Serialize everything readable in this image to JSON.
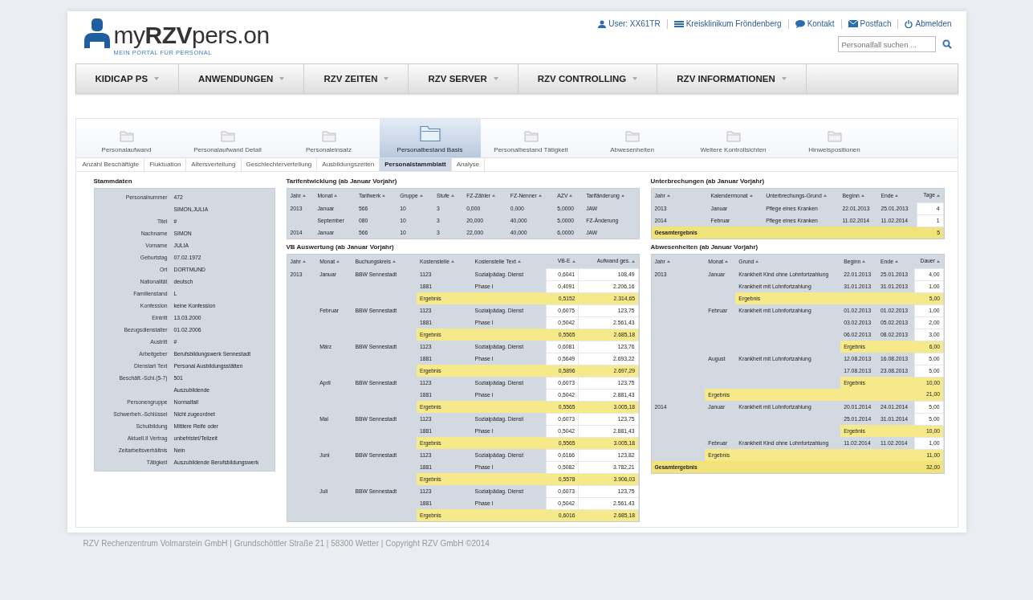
{
  "logo": {
    "name": "my**RZV**pers.on",
    "tagline": "MEIN PORTAL FÜR PERSONAL"
  },
  "top_links": [
    {
      "kind": "user",
      "label": "User: XX61TR"
    },
    {
      "kind": "org",
      "label": "Kreisklinikum Fröndenberg"
    },
    {
      "kind": "contact",
      "label": "Kontakt"
    },
    {
      "kind": "mail",
      "label": "Postfach"
    },
    {
      "kind": "logout",
      "label": "Abmelden"
    }
  ],
  "search": {
    "placeholder": "Personalfall suchen ..."
  },
  "menu": [
    "KIDICAP PS",
    "ANWENDUNGEN",
    "RZV ZEITEN",
    "RZV SERVER",
    "RZV CONTROLLING",
    "RZV INFORMATIONEN"
  ],
  "tabs": [
    {
      "label": "Personalaufwand",
      "selected": false
    },
    {
      "label": "Personalaufwand Detail",
      "selected": false
    },
    {
      "label": "Personaleinsatz",
      "selected": false
    },
    {
      "label": "Personalbestand Basis",
      "selected": true
    },
    {
      "label": "Personalbestand Tätigkeit",
      "selected": false
    },
    {
      "label": "Abwesenheiten",
      "selected": false
    },
    {
      "label": "Weitere Kontrollsichten",
      "selected": false
    },
    {
      "label": "Hinweispositionen",
      "selected": false
    }
  ],
  "subtabs": [
    {
      "label": "Anzahl Beschäftigte",
      "selected": false
    },
    {
      "label": "Fluktuation",
      "selected": false
    },
    {
      "label": "Altersverteilung",
      "selected": false
    },
    {
      "label": "Geschlechterverteilung",
      "selected": false
    },
    {
      "label": "Ausbildungszeiten",
      "selected": false
    },
    {
      "label": "Personalstammblatt",
      "selected": true
    },
    {
      "label": "Analyse",
      "selected": false
    }
  ],
  "stammdaten": {
    "title": "Stammdaten",
    "fields": [
      {
        "label": "Personalnummer",
        "value": "472"
      },
      {
        "value": "SIMON,JULIA"
      },
      {
        "label": "Titel",
        "value": "#"
      },
      {
        "label": "Nachname",
        "value": "SIMON"
      },
      {
        "label": "Vorname",
        "value": "JULIA"
      },
      {
        "label": "Geburtstag",
        "value": "07.02.1972"
      },
      {
        "label": "Ort",
        "value": "DORTMUND"
      },
      {
        "label": "Nationalität",
        "value": "deutsch"
      },
      {
        "label": "Familienstand",
        "value": "L"
      },
      {
        "label": "Konfession",
        "value": "keine Konfession"
      },
      {
        "label": "Eintritt",
        "value": "13.03.2000"
      },
      {
        "label": "Bezugsdienstalter",
        "value": "01.02.2006"
      },
      {
        "label": "Austritt",
        "value": "#"
      },
      {
        "label": "Arbeitgeber",
        "value": "Berufsbildungswerk Sennestadt"
      },
      {
        "label": "Dienstart Text",
        "value": "Personal Ausbildungsstätten"
      },
      {
        "label": "Beschäft.-Schl.(5-7)",
        "value": "501"
      },
      {
        "value": "Auszubildende"
      },
      {
        "label": "Personengruppe",
        "value": "Normalfall"
      },
      {
        "label": "Schwerbeh.-Schlüssel",
        "value": "Nicht zugeordnet"
      },
      {
        "label": "Schulbildung",
        "value": "Mittlere Reife oder"
      },
      {
        "label": "Aktuell.II Vertrag",
        "value": "unbefristet/Teilzeit"
      },
      {
        "label": "Zeitarbeitsverhältnis",
        "value": "Nein"
      },
      {
        "label": "Tätigkeit",
        "value": "Auszubildende Berufsbildungswerk"
      }
    ]
  },
  "tarifentwicklung": {
    "title": "Tarifentwicklung (ab Januar Vorjahr)",
    "columns": [
      {
        "label": "Jahr"
      },
      {
        "label": "Monat"
      },
      {
        "label": "Tarifwerk"
      },
      {
        "label": "Gruppe"
      },
      {
        "label": "Stufe"
      },
      {
        "label": "FZ-Zähler"
      },
      {
        "label": "FZ-Nenner"
      },
      {
        "label": "AZV"
      },
      {
        "label": "Tarifänderung"
      }
    ],
    "rows": [
      {
        "kind": "data",
        "cells": [
          "2013",
          "Januar",
          "566",
          "10",
          "3",
          "0,000",
          "0,000",
          "5,0000",
          "JAW"
        ]
      },
      {
        "kind": "data",
        "cells": [
          null,
          "September",
          "080",
          "10",
          "3",
          "20,000",
          "40,000",
          "5,0000",
          "FZ-Änderung"
        ]
      },
      {
        "kind": "data",
        "cells": [
          "2014",
          "Januar",
          "566",
          "10",
          "3",
          "22,000",
          "40,000",
          "6,0000",
          "JAW"
        ]
      }
    ]
  },
  "vb_auswertung": {
    "title": "VB Auswertung (ab Januar Vorjahr)",
    "columns": [
      {
        "label": "Jahr",
        "kind": "text"
      },
      {
        "label": "Monat",
        "kind": "text"
      },
      {
        "label": "Buchungskreis",
        "kind": "text"
      },
      {
        "label": "Kostenstelle",
        "kind": "text"
      },
      {
        "label": "Kostenstelle Text",
        "kind": "text"
      },
      {
        "label": "VB-E",
        "kind": "number"
      },
      {
        "label": "Aufwand ges.",
        "kind": "number"
      }
    ],
    "rows": [
      {
        "kind": "data",
        "cells": [
          "2013",
          "Januar",
          "BBW Sennestadt",
          "1123",
          "Sozialpädag. Dienst",
          "0,6041",
          "108,49"
        ]
      },
      {
        "kind": "data",
        "cells": [
          null,
          null,
          null,
          "1881",
          "Phase I",
          "0,4091",
          "2.206,16"
        ]
      },
      {
        "kind": "sum",
        "cells": [
          null,
          null,
          null,
          "Ergebnis",
          null,
          "0,5152",
          "2.314,65"
        ]
      },
      {
        "kind": "data",
        "cells": [
          null,
          "Februar",
          "BBW Sennestadt",
          "1123",
          "Sozialpädag. Dienst",
          "0,6075",
          "123,75"
        ]
      },
      {
        "kind": "data",
        "cells": [
          null,
          null,
          null,
          "1881",
          "Phase I",
          "0,5042",
          "2.561,43"
        ]
      },
      {
        "kind": "sum",
        "cells": [
          null,
          null,
          null,
          "Ergebnis",
          null,
          "0,5565",
          "2.685,18"
        ]
      },
      {
        "kind": "data",
        "cells": [
          null,
          "März",
          "BBW Sennestadt",
          "1123",
          "Sozialpädag. Dienst",
          "0,6081",
          "123,76"
        ]
      },
      {
        "kind": "data",
        "cells": [
          null,
          null,
          null,
          "1881",
          "Phase I",
          "0,5649",
          "2.693,22"
        ]
      },
      {
        "kind": "sum",
        "cells": [
          null,
          null,
          null,
          "Ergebnis",
          null,
          "0,5896",
          "2.697,29"
        ]
      },
      {
        "kind": "data",
        "cells": [
          null,
          "April",
          "BBW Sennestadt",
          "1123",
          "Sozialpädag. Dienst",
          "0,6073",
          "123,75"
        ]
      },
      {
        "kind": "data",
        "cells": [
          null,
          null,
          null,
          "1881",
          "Phase I",
          "0,5042",
          "2.881,43"
        ]
      },
      {
        "kind": "sum",
        "cells": [
          null,
          null,
          null,
          "Ergebnis",
          null,
          "0,5565",
          "3.005,18"
        ]
      },
      {
        "kind": "data",
        "cells": [
          null,
          "Mai",
          "BBW Sennestadt",
          "1123",
          "Sozialpädag. Dienst",
          "0,6073",
          "123,75"
        ]
      },
      {
        "kind": "data",
        "cells": [
          null,
          null,
          null,
          "1881",
          "Phase I",
          "0,5042",
          "2.881,43"
        ]
      },
      {
        "kind": "sum",
        "cells": [
          null,
          null,
          null,
          "Ergebnis",
          null,
          "0,5565",
          "3.005,18"
        ]
      },
      {
        "kind": "data",
        "cells": [
          null,
          "Juni",
          "BBW Sennestadt",
          "1123",
          "Sozialpädag. Dienst",
          "0,6166",
          "123,82"
        ]
      },
      {
        "kind": "data",
        "cells": [
          null,
          null,
          null,
          "1881",
          "Phase I",
          "0,5082",
          "3.782,21"
        ]
      },
      {
        "kind": "sum",
        "cells": [
          null,
          null,
          null,
          "Ergebnis",
          null,
          "0,5578",
          "3.906,03"
        ]
      },
      {
        "kind": "data",
        "cells": [
          null,
          "Juli",
          "BBW Sennestadt",
          "1123",
          "Sozialpädag. Dienst",
          "0,6073",
          "123,75"
        ]
      },
      {
        "kind": "data",
        "cells": [
          null,
          null,
          null,
          "1881",
          "Phase I",
          "0,5042",
          "2.561,43"
        ]
      },
      {
        "kind": "sum",
        "cells": [
          null,
          null,
          null,
          "Ergebnis",
          null,
          "0,6016",
          "2.685,18"
        ]
      }
    ]
  },
  "unterbrechungen": {
    "title": "Unterbrechungen (ab Januar Vorjahr)",
    "columns": [
      {
        "label": "Jahr",
        "kind": "text"
      },
      {
        "label": "Kalendermonat",
        "kind": "text"
      },
      {
        "label": "Unterbrechungs-Grund",
        "kind": "text"
      },
      {
        "label": "Beginn",
        "kind": "text"
      },
      {
        "label": "Ende",
        "kind": "text"
      },
      {
        "label": "Tage",
        "kind": "number"
      }
    ],
    "rows": [
      {
        "kind": "data",
        "cells": [
          "2013",
          "Januar",
          "Pflege eines Kranken",
          "22.01.2013",
          "25.01.2013",
          "4"
        ]
      },
      {
        "kind": "data",
        "cells": [
          "2014",
          "Februar",
          "Pflege eines Kranken",
          "11.02.2014",
          "11.02.2014",
          "1"
        ]
      },
      {
        "kind": "total",
        "cells": [
          "Gesamtergebnis",
          null,
          null,
          null,
          null,
          "5"
        ]
      }
    ]
  },
  "abwesenheiten": {
    "title": "Abwesenheiten (ab Januar Vorjahr)",
    "columns": [
      {
        "label": "Jahr",
        "kind": "text"
      },
      {
        "label": "Monat",
        "kind": "text"
      },
      {
        "label": "Grund",
        "kind": "text"
      },
      {
        "label": "Beginn",
        "kind": "text"
      },
      {
        "label": "Ende",
        "kind": "text"
      },
      {
        "label": "Dauer",
        "kind": "number"
      }
    ],
    "rows": [
      {
        "kind": "data",
        "cells": [
          "2013",
          "Januar",
          "Krankheit Kind ohne Lohnfortzahlung",
          "22.01.2013",
          "25.01.2013",
          "4,00"
        ]
      },
      {
        "kind": "data",
        "cells": [
          null,
          null,
          "Krankheit mit Lohnfortzahlung",
          "31.01.2013",
          "31.01.2013",
          "1,00"
        ]
      },
      {
        "kind": "sum",
        "cells": [
          null,
          null,
          "Ergebnis",
          null,
          null,
          "5,00"
        ]
      },
      {
        "kind": "data",
        "cells": [
          null,
          "Februar",
          "Krankheit mit Lohnfortzahlung",
          "01.02.2013",
          "01.02.2013",
          "1,00"
        ]
      },
      {
        "kind": "data",
        "cells": [
          null,
          null,
          null,
          "03.02.2013",
          "05.02.2013",
          "2,00"
        ]
      },
      {
        "kind": "data",
        "cells": [
          null,
          null,
          null,
          "06.02.2013",
          "08.02.2013",
          "3,00"
        ]
      },
      {
        "kind": "sum",
        "cells": [
          null,
          null,
          null,
          "Ergebnis",
          null,
          "6,00"
        ]
      },
      {
        "kind": "data",
        "cells": [
          null,
          "August",
          "Krankheit mit Lohnfortzahlung",
          "12.08.2013",
          "16.08.2013",
          "5,00"
        ]
      },
      {
        "kind": "data",
        "cells": [
          null,
          null,
          null,
          "17.08.2013",
          "23.08.2013",
          "5,00"
        ]
      },
      {
        "kind": "sum",
        "cells": [
          null,
          null,
          null,
          "Ergebnis",
          null,
          "10,00"
        ]
      },
      {
        "kind": "sum",
        "cells": [
          null,
          "Ergebnis",
          null,
          null,
          null,
          "21,00"
        ]
      },
      {
        "kind": "data",
        "cells": [
          "2014",
          "Januar",
          "Krankheit mit Lohnfortzahlung",
          "20.01.2014",
          "24.01.2014",
          "5,00"
        ]
      },
      {
        "kind": "data",
        "cells": [
          null,
          null,
          null,
          "25.01.2014",
          "31.01.2014",
          "5,00"
        ]
      },
      {
        "kind": "sum",
        "cells": [
          null,
          null,
          null,
          "Ergebnis",
          null,
          "10,00"
        ]
      },
      {
        "kind": "data",
        "cells": [
          null,
          "Februar",
          "Krankheit Kind ohne Lohnfortzahlung",
          "11.02.2014",
          "11.02.2014",
          "1,00"
        ]
      },
      {
        "kind": "sum",
        "cells": [
          null,
          "Ergebnis",
          null,
          null,
          null,
          "11,00"
        ]
      },
      {
        "kind": "total",
        "cells": [
          "Gesamtergebnis",
          null,
          null,
          null,
          null,
          "32,00"
        ]
      }
    ]
  },
  "footer": "RZV Rechenzentrum Volmarstein GmbH | Grundschöttler Straße 21 | 58300 Wetter | Copyright RZV GmbH ©2014"
}
